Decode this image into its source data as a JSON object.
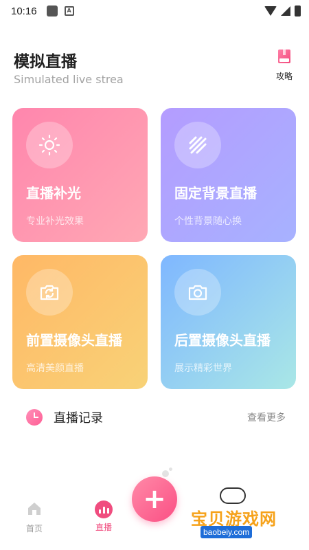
{
  "status_bar": {
    "time": "10:16"
  },
  "header": {
    "title": "模拟直播",
    "subtitle": "Simulated live strea",
    "guide_label": "攻略"
  },
  "cards": [
    {
      "title": "直播补光",
      "desc": "专业补光效果",
      "icon": "sun-icon",
      "color": "#ff86ad"
    },
    {
      "title": "固定背景直播",
      "desc": "个性背景随心换",
      "icon": "stripes-icon",
      "color": "#b49cff"
    },
    {
      "title": "前置摄像头直播",
      "desc": "高清美颜直播",
      "icon": "camera-switch-icon",
      "color": "#ffb866"
    },
    {
      "title": "后置摄像头直播",
      "desc": "展示精彩世界",
      "icon": "camera-icon",
      "color": "#7fb7ff"
    }
  ],
  "records": {
    "label": "直播记录",
    "more": "查看更多"
  },
  "nav": {
    "home": "首页",
    "live": "直播",
    "accent": "#f04d7f"
  },
  "watermark": {
    "title": "宝贝游戏网",
    "url": "baobeiy.com"
  }
}
